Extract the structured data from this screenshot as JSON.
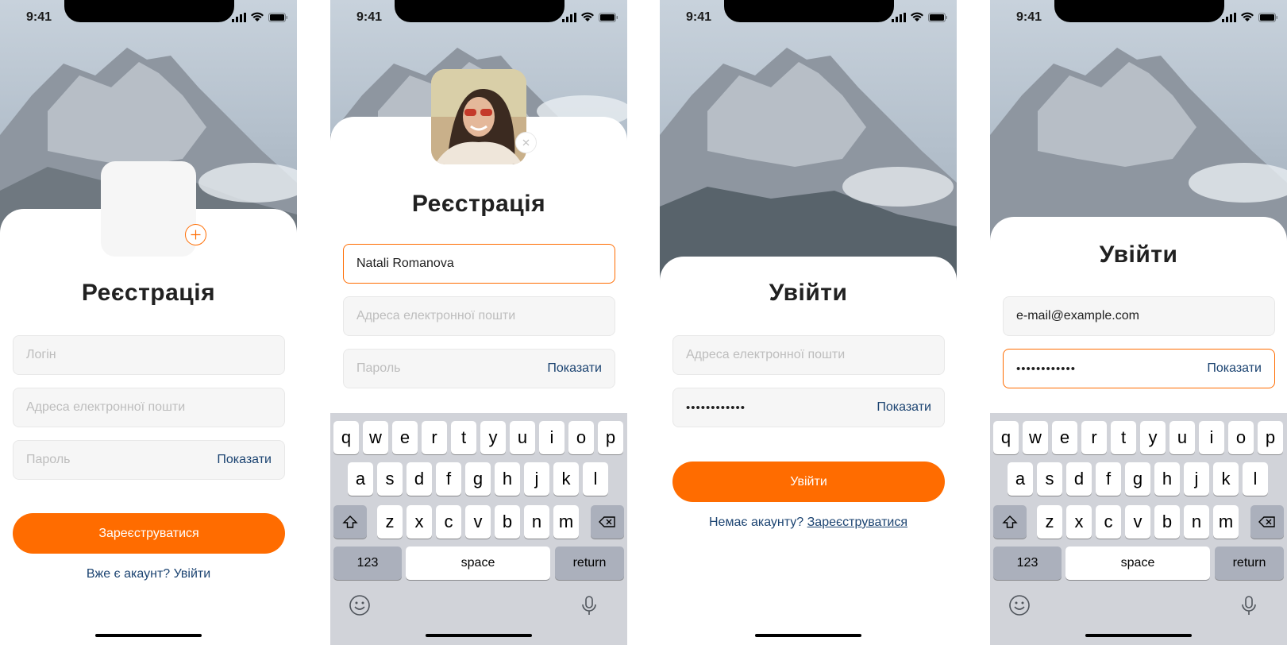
{
  "status": {
    "time": "9:41"
  },
  "register": {
    "title": "Реєстрація",
    "login_placeholder": "Логін",
    "email_placeholder": "Адреса електронної пошти",
    "password_placeholder": "Пароль",
    "show_label": "Показати",
    "submit_label": "Зареєструватися",
    "login_link": "Вже є акаунт? Увійти"
  },
  "register_filled": {
    "title": "Реєстрація",
    "login_value": "Natali Romanova",
    "email_placeholder": "Адреса електронної пошти",
    "password_placeholder": "Пароль",
    "show_label": "Показати"
  },
  "login": {
    "title": "Увійти",
    "email_placeholder": "Адреса електронної пошти",
    "password_value": "••••••••••••",
    "show_label": "Показати",
    "submit_label": "Увійти",
    "prompt": "Немає акаунту?",
    "register_link": "Зареєструватися"
  },
  "login_filled": {
    "title": "Увійти",
    "email_value": "e-mail@example.com",
    "password_value": "••••••••••••",
    "show_label": "Показати"
  },
  "keyboard": {
    "row1": [
      "q",
      "w",
      "e",
      "r",
      "t",
      "y",
      "u",
      "i",
      "o",
      "p"
    ],
    "row2": [
      "a",
      "s",
      "d",
      "f",
      "g",
      "h",
      "j",
      "k",
      "l"
    ],
    "row3": [
      "z",
      "x",
      "c",
      "v",
      "b",
      "n",
      "m"
    ],
    "numbers_label": "123",
    "space_label": "space",
    "return_label": "return"
  },
  "colors": {
    "accent": "#FF6C00",
    "link": "#1B4371",
    "field_bg": "#F6F6F6",
    "keyboard_bg": "#D1D3D9"
  }
}
